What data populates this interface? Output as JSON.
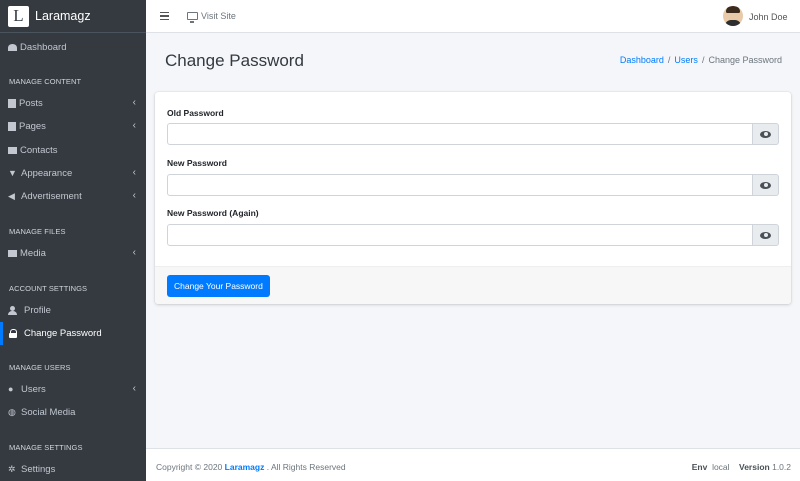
{
  "brand": {
    "logo_letter": "L",
    "name": "Laramagz"
  },
  "topbar": {
    "visit_label": "Visit Site",
    "user_name": "John Doe"
  },
  "sidebar": {
    "dashboard": "Dashboard",
    "header_content": "MANAGE CONTENT",
    "posts": "Posts",
    "pages": "Pages",
    "contacts": "Contacts",
    "appearance": "Appearance",
    "advertisement": "Advertisement",
    "header_files": "MANAGE FILES",
    "media": "Media",
    "header_account": "ACCOUNT SETTINGS",
    "profile": "Profile",
    "change_password": "Change Password",
    "header_users": "MANAGE USERS",
    "users": "Users",
    "social_media": "Social Media",
    "header_settings": "MANAGE SETTINGS",
    "settings": "Settings",
    "active_item": "Change Password"
  },
  "page": {
    "title": "Change Password"
  },
  "breadcrumb": {
    "dashboard": "Dashboard",
    "users": "Users",
    "separator": "/",
    "current": "Change Password"
  },
  "form": {
    "old_label": "Old Password",
    "old_value": "",
    "new_label": "New Password",
    "new_value": "",
    "again_label": "New Password (Again)",
    "again_value": "",
    "submit_label": "Change Your Password"
  },
  "footer": {
    "copyright_prefix": "Copyright © 2020",
    "brand": "Laramagz",
    "copyright_suffix": ". All Rights Reserved",
    "env_label": "Env",
    "env_value": "local",
    "version_label": "Version",
    "version_value": "1.0.2"
  },
  "colors": {
    "sidebar_bg": "#343a40",
    "accent": "#007bff",
    "page_bg": "#f4f6f9"
  }
}
